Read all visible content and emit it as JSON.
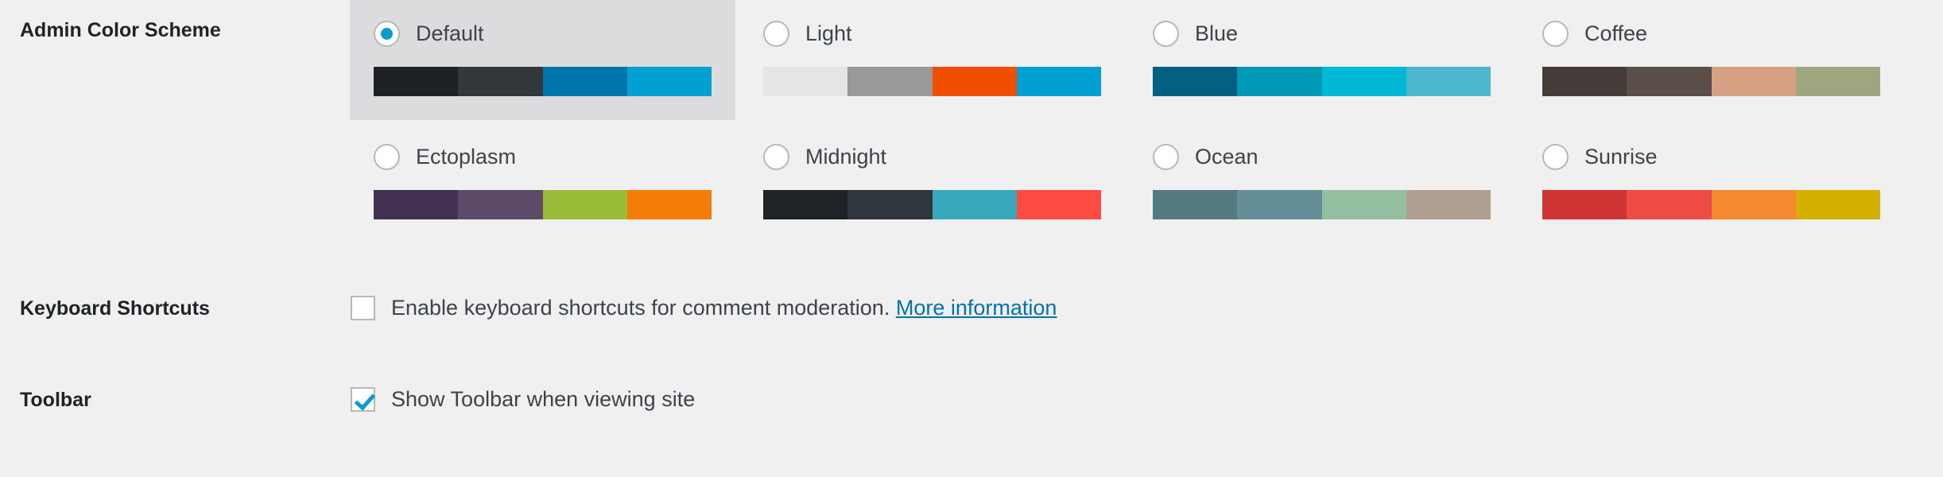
{
  "page": {
    "background": "#f0f0f1",
    "accent": "#0d9bd0",
    "link_color": "#0073aa"
  },
  "rows": {
    "color_scheme": {
      "label": "Admin Color Scheme",
      "selected": "Default",
      "options": [
        {
          "name": "Default",
          "selected": true,
          "colors": [
            "#1d2124",
            "#32373c",
            "#0073aa",
            "#00a0d2"
          ]
        },
        {
          "name": "Light",
          "selected": false,
          "colors": [
            "#e5e5e5",
            "#999999",
            "#f04e00",
            "#00a0d2"
          ]
        },
        {
          "name": "Blue",
          "selected": false,
          "colors": [
            "#036080",
            "#0099b5",
            "#00b9d6",
            "#4cb7cd"
          ]
        },
        {
          "name": "Coffee",
          "selected": false,
          "colors": [
            "#453c39",
            "#5a4e49",
            "#d6a183",
            "#9da67f"
          ]
        },
        {
          "name": "Ectoplasm",
          "selected": false,
          "colors": [
            "#423050",
            "#5c4a68",
            "#9bbc38",
            "#f47d09"
          ]
        },
        {
          "name": "Midnight",
          "selected": false,
          "colors": [
            "#1f2328",
            "#30363d",
            "#38a9bd",
            "#fc4b42"
          ]
        },
        {
          "name": "Ocean",
          "selected": false,
          "colors": [
            "#527a80",
            "#648f98",
            "#91bfa0",
            "#b0a091"
          ]
        },
        {
          "name": "Sunrise",
          "selected": false,
          "colors": [
            "#cf3534",
            "#ee4b45",
            "#f4892f",
            "#d4b000"
          ]
        }
      ]
    },
    "keyboard_shortcuts": {
      "label": "Keyboard Shortcuts",
      "checkbox_label": "Enable keyboard shortcuts for comment moderation.",
      "link_label": "More information",
      "checked": false
    },
    "toolbar": {
      "label": "Toolbar",
      "checkbox_label": "Show Toolbar when viewing site",
      "checked": true
    }
  }
}
